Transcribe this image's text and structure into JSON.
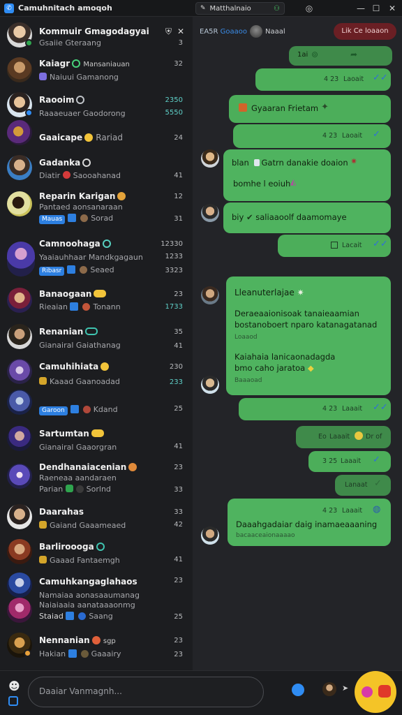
{
  "window": {
    "title": "Camuhnitach amoqoh",
    "tab_label": "Matthalnaio",
    "controls": [
      "help-icon",
      "minimize-icon",
      "maximize-icon",
      "close-icon"
    ]
  },
  "sidebar": {
    "chats": [
      {
        "name": "Kommuir Gmagodagyai",
        "preview": "Gsaiie Gteraang",
        "time": "3"
      },
      {
        "name": "Kaiagr",
        "preview": "Naiuui Gamanong",
        "time": "32",
        "sub": "Mansaniauan"
      },
      {
        "name": "Raooim",
        "preview": "Raaaeuaer Gaodorong",
        "time": "2350",
        "time2": "5550"
      },
      {
        "name": "Gaaicape",
        "preview": "Rariad",
        "time": "24"
      },
      {
        "name": "Gadanka",
        "preview": "Diatir",
        "preview2": "Saooahanad",
        "time": "41"
      },
      {
        "name": "Reparin Karigan",
        "preview": "Pantaed aonsanaraan",
        "tag": "Mauas",
        "preview2": "Sorad",
        "time": "12",
        "time2": "31"
      },
      {
        "name": "Camnoohaga",
        "preview": "Yaaiauhhaar Mandkgagaun",
        "tag": "Ribasr",
        "preview2": "Seaed",
        "time": "12330",
        "time2": "1233",
        "time3": "3323"
      },
      {
        "name": "Banaogaan",
        "preview": "Rieaian",
        "preview2": "Tonann",
        "time": "23",
        "time2": "1733"
      },
      {
        "name": "Renanian",
        "preview": "Gianairal",
        "preview2": "Gaiathanag",
        "time": "35",
        "time2": "41"
      },
      {
        "name": "Camuhihiata",
        "preview": "Kaaad",
        "preview2": "Gaanoadad",
        "tag": "Garoon",
        "preview3": "Kdand",
        "time": "230",
        "time2": "233",
        "time3": "25"
      },
      {
        "name": "Sartumtan",
        "preview": "Gianairal",
        "preview2": "Gaaorgran",
        "time": "41"
      },
      {
        "name": "Dendhanaiacenian",
        "preview": "Raeneaa aandaraen",
        "preview2": "Parian",
        "preview3": "Sorlnd",
        "time": "23",
        "time2": "33"
      },
      {
        "name": "Daarahas",
        "preview": "Gaiand",
        "preview2": "Gaaameaed",
        "time": "33",
        "time2": "42"
      },
      {
        "name": "Barliroooga",
        "preview": "Gaaad",
        "preview2": "Fantaemgh",
        "time": "41"
      },
      {
        "name": "Camuhkangaglahaos",
        "preview": "Namaiaa aonasaaumanag",
        "preview2": "Naiaiaaia aanataaaonmg",
        "tag": "Staiad",
        "preview3": "Saang",
        "time": "23",
        "time2": "25"
      },
      {
        "name": "Nennanian",
        "preview": "Hakian",
        "preview2": "Gaaairy",
        "time": "23",
        "time2": "23",
        "extra": "sgp"
      }
    ]
  },
  "main": {
    "header_left": "EA5R",
    "header_left_blue": "Goaaoo",
    "header_name": "Naaal",
    "header_button": "Lik Ce loaaon",
    "messages": {
      "m1_text": "1ai",
      "m1_time": "4 23",
      "m1_status": "Laoait",
      "m2_text": "Gyaaran Frietam",
      "m3_time": "4 23",
      "m3_status": "Laoait",
      "m4_line1": "blan",
      "m4_line1b": "Gatrn danakie doaion",
      "m4_line2": "bomhe l eoiuh",
      "m5_text": "biy",
      "m5_text2": "saliaaoolf daamomaye",
      "m6_status": "Lacait",
      "m7_title": "Lleanuterlajae",
      "m7_line1": "Deraeaaionisoak tanaieaamian",
      "m7_line2": "bostanoboert nparo katanagatanad",
      "m7_meta1": "Loaaod",
      "m7_line3": "Kaiahaia lanicaonadagda",
      "m7_line4": "bmo caho",
      "m7_line4b": "jaratoa",
      "m7_meta2": "Baaaoad",
      "m8_time": "4 23",
      "m8_status": "Laaait",
      "m9_label": "Eo",
      "m9_status": "Laaait",
      "m9_extra": "Dr of",
      "m10_time": "3 25",
      "m10_status": "Laaait",
      "m11_status": "Lanaat",
      "m12_time": "4 23",
      "m12_status": "Laaait",
      "m12_line1": "Daaahgadaiar daig inamaeaaaning",
      "m12_line2": "bacaaceaionaaaao"
    }
  },
  "composer": {
    "placeholder": "Daaiar Vanmagnh..."
  }
}
